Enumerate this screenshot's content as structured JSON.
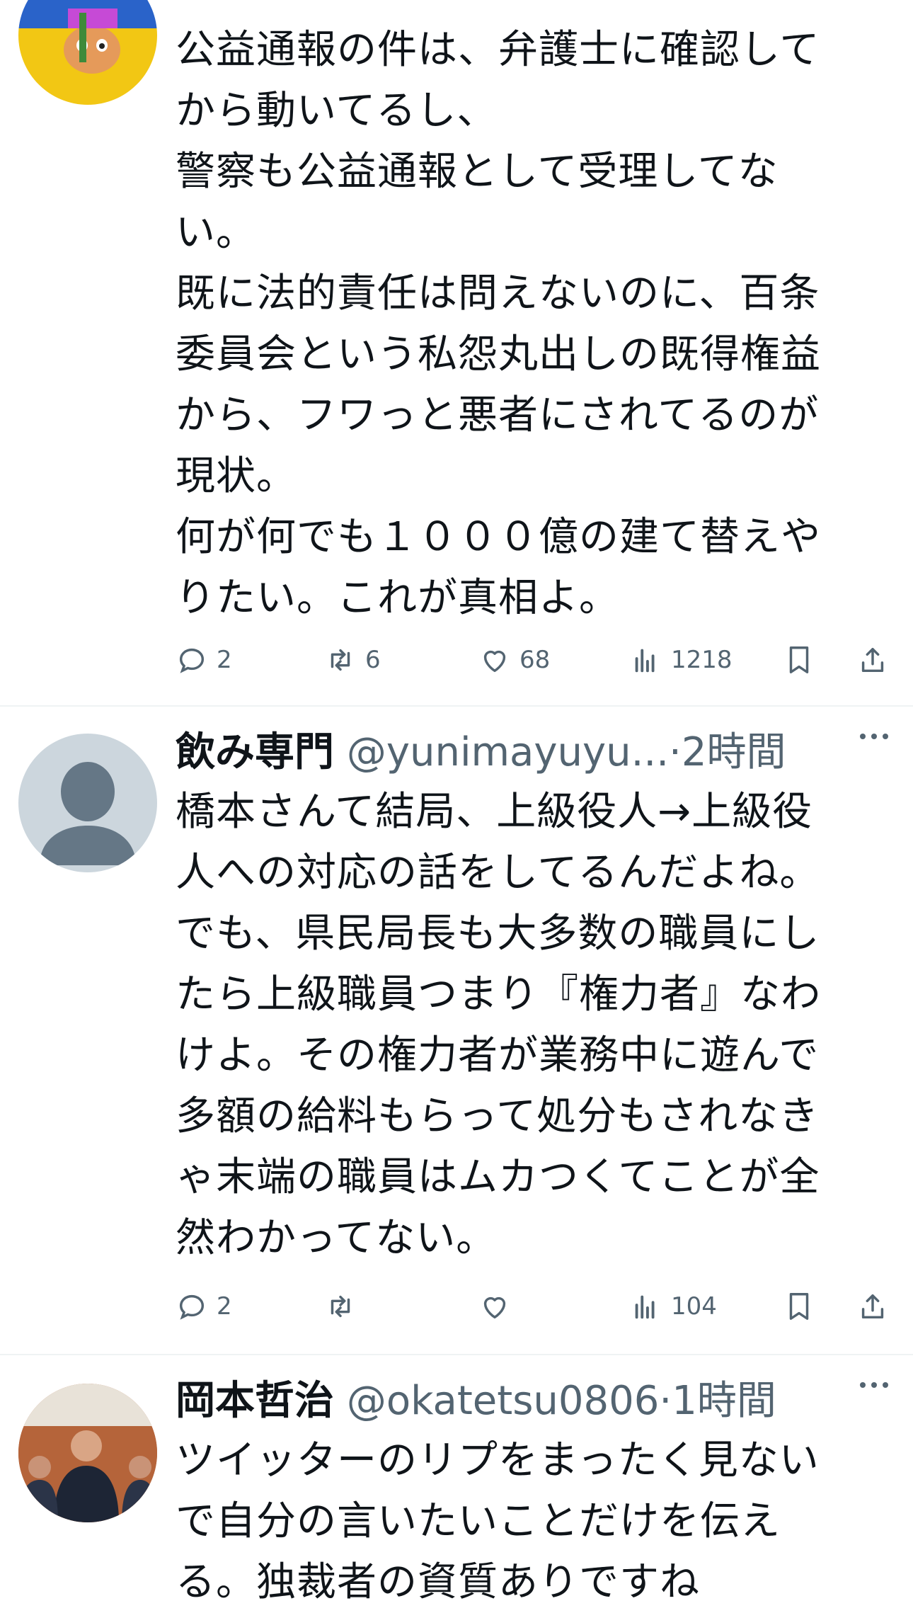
{
  "tweets": [
    {
      "name": "",
      "handle": "",
      "time": "",
      "body": "公益通報の件は、弁護士に確認して\nから動いてるし、\n警察も公益通報として受理してな\nい。\n既に法的責任は問えないのに、百条\n委員会という私怨丸出しの既得権益\nから、フワっと悪者にされてるのが\n現状。\n何が何でも１０００億の建て替えや\nりたい。これが真相よ。",
      "replies": "2",
      "retweets": "6",
      "likes": "68",
      "views": "1218"
    },
    {
      "name": "飲み専門",
      "handle": "@yunimayuyu...",
      "time": "2時間",
      "body": "橋本さんて結局、上級役人→上級役\n人への対応の話をしてるんだよね。\nでも、県民局長も大多数の職員にし\nたら上級職員つまり『権力者』なわ\nけよ。その権力者が業務中に遊んで\n多額の給料もらって処分もされなき\nゃ末端の職員はムカつくてことが全\n然わかってない。",
      "replies": "2",
      "retweets": "",
      "likes": "",
      "views": "104"
    },
    {
      "name": "岡本哲治",
      "handle": "@okatetsu0806",
      "time": "1時間",
      "body": "ツイッターのリプをまったく見ない\nで自分の言いたいことだけを伝え\nる。独裁者の資質ありですね"
    }
  ],
  "separator": "·",
  "colors": {
    "text": "#0f1419",
    "secondary": "#536471",
    "divider": "#eff3f4"
  },
  "icons": [
    "reply-icon",
    "retweet-icon",
    "like-icon",
    "views-icon",
    "bookmark-icon",
    "share-icon",
    "more-icon"
  ]
}
